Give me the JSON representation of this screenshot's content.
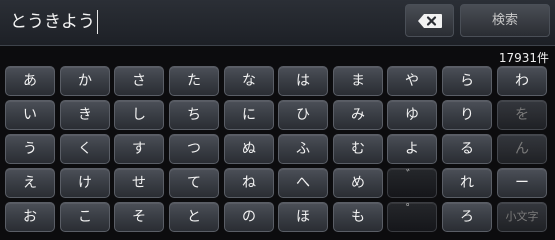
{
  "search": {
    "input_value": "とうきよう",
    "delete_icon": "backspace-icon",
    "search_label": "検索"
  },
  "result_count": "17931件",
  "keyboard": {
    "columns": [
      [
        "あ",
        "い",
        "う",
        "え",
        "お"
      ],
      [
        "か",
        "き",
        "く",
        "け",
        "こ"
      ],
      [
        "さ",
        "し",
        "す",
        "せ",
        "そ"
      ],
      [
        "た",
        "ち",
        "つ",
        "て",
        "と"
      ],
      [
        "な",
        "に",
        "ぬ",
        "ね",
        "の"
      ],
      [
        "は",
        "ひ",
        "ふ",
        "へ",
        "ほ"
      ],
      [
        "ま",
        "み",
        "む",
        "め",
        "も"
      ],
      [
        "や",
        "ゆ",
        "よ",
        "゛",
        "゜"
      ],
      [
        "ら",
        "り",
        "る",
        "れ",
        "ろ"
      ],
      [
        "わ",
        "を",
        "ん",
        "ー",
        "小文字"
      ]
    ]
  }
}
